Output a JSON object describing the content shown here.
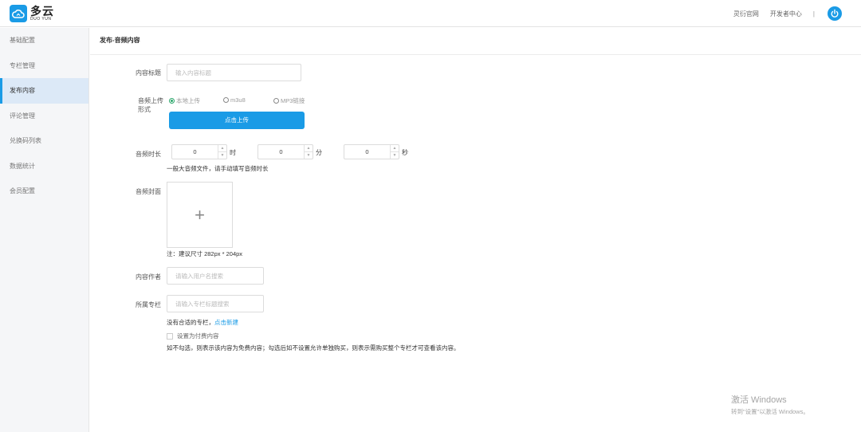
{
  "header": {
    "logo_cn": "多云",
    "logo_en": "DUO YUN",
    "links": [
      "灵衍官网",
      "开发者中心"
    ],
    "separator": "|",
    "accent": "#1a9be6"
  },
  "sidebar": {
    "items": [
      {
        "label": "基础配置"
      },
      {
        "label": "专栏管理"
      },
      {
        "label": "发布内容"
      },
      {
        "label": "评论管理"
      },
      {
        "label": "兑换码列表"
      },
      {
        "label": "数据统计"
      },
      {
        "label": "会员配置"
      }
    ],
    "active": "发布内容"
  },
  "main": {
    "title": "发布-音频内容",
    "form": {
      "content_title": {
        "label": "内容标题",
        "placeholder": "输入内容标题",
        "value": ""
      },
      "upload_method": {
        "label_line1": "音频上传",
        "label_line2": "形式",
        "options": [
          "本地上传",
          "m3u8",
          "MP3链接"
        ],
        "selected": "本地上传",
        "button": "点击上传"
      },
      "duration": {
        "label": "音频时长",
        "hours": "0",
        "hours_unit": "时",
        "minutes": "0",
        "minutes_unit": "分",
        "seconds": "0",
        "seconds_unit": "秒",
        "hint": "一般大音频文件，请手动填写音频时长"
      },
      "cover": {
        "label": "音频封面",
        "plus": "+",
        "note": "注：建议尺寸 282px * 204px"
      },
      "author": {
        "label": "内容作者",
        "placeholder": "请输入用户名搜索",
        "value": ""
      },
      "column": {
        "label": "所属专栏",
        "placeholder": "请输入专栏标题搜索",
        "value": "",
        "no_match": "没有合适的专栏，",
        "create_link": "点击新建"
      },
      "paid": {
        "label": "设置为付费内容",
        "checked": false,
        "explain": "如不勾选，则表示该内容为免费内容；勾选后如不设置允许单独购买，则表示需购买整个专栏才可查看该内容。"
      }
    }
  },
  "watermark": {
    "line1": "激活 Windows",
    "line2": "转到\"设置\"以激活 Windows。"
  }
}
